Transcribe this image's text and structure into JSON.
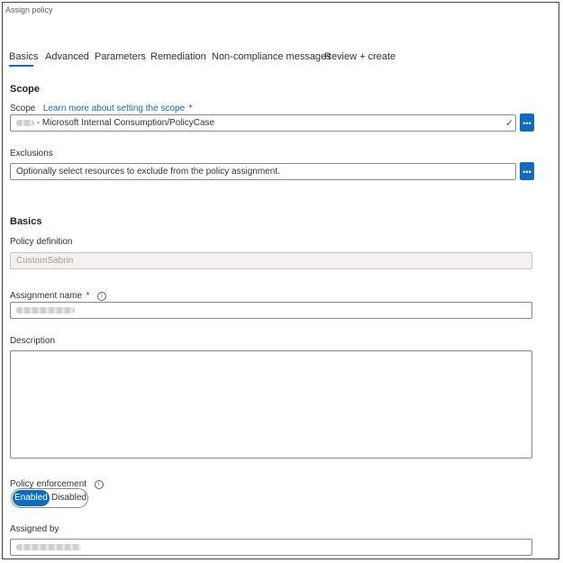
{
  "window": {
    "title": "Assign policy"
  },
  "tabs": [
    "Basics",
    "Advanced",
    "Parameters",
    "Remediation",
    "Non-compliance messages",
    "Review + create"
  ],
  "scope": {
    "heading": "Scope",
    "label": "Scope",
    "learn_more": "Learn more about setting the scope",
    "required_mark": "*",
    "value": " - Microsoft Internal Consumption/PolicyCase",
    "browse_icon": "ellipsis-icon",
    "valid_icon": "checkmark-icon"
  },
  "exclusions": {
    "label": "Exclusions",
    "placeholder": "Optionally select resources to exclude from the policy assignment.",
    "browse_icon": "ellipsis-icon"
  },
  "basics": {
    "heading": "Basics",
    "policy_definition_label": "Policy definition",
    "policy_definition_value": "CustomSabrin",
    "assignment_name_label": "Assignment name",
    "assignment_name_required": "*",
    "info_icon": "info-icon",
    "description_label": "Description",
    "policy_enforcement_label": "Policy enforcement",
    "enforcement_options": [
      "Enabled",
      "Disabled"
    ],
    "enforcement_selected": "Enabled",
    "assigned_by_label": "Assigned by"
  },
  "colors": {
    "accent": "#0f6cbd",
    "required": "#c50f1f",
    "valid": "#107c10"
  }
}
